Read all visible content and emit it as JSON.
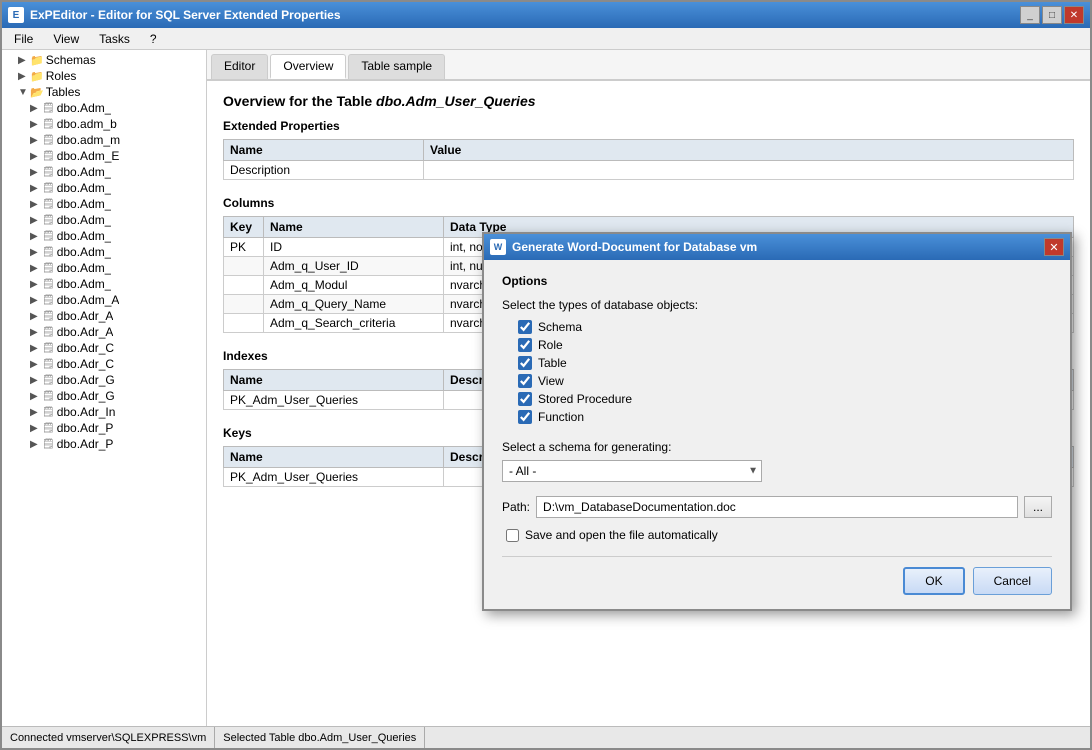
{
  "window": {
    "title": "ExPEditor - Editor for SQL Server Extended Properties",
    "icon_text": "E"
  },
  "menu": {
    "items": [
      "File",
      "View",
      "Tasks",
      "?"
    ]
  },
  "sidebar": {
    "items": [
      {
        "label": "Schemas",
        "type": "folder",
        "indent": 1,
        "arrow": "▶"
      },
      {
        "label": "Roles",
        "type": "folder",
        "indent": 1,
        "arrow": "▶"
      },
      {
        "label": "Tables",
        "type": "folder",
        "indent": 1,
        "arrow": "▼"
      },
      {
        "label": "dbo.Adm_",
        "type": "table",
        "indent": 2,
        "arrow": "▶"
      },
      {
        "label": "dbo.adm_b",
        "type": "table",
        "indent": 2,
        "arrow": "▶"
      },
      {
        "label": "dbo.adm_m",
        "type": "table",
        "indent": 2,
        "arrow": "▶"
      },
      {
        "label": "dbo.Adm_E",
        "type": "table",
        "indent": 2,
        "arrow": "▶"
      },
      {
        "label": "dbo.Adm_",
        "type": "table",
        "indent": 2,
        "arrow": "▶"
      },
      {
        "label": "dbo.Adm_",
        "type": "table",
        "indent": 2,
        "arrow": "▶"
      },
      {
        "label": "dbo.Adm_",
        "type": "table",
        "indent": 2,
        "arrow": "▶"
      },
      {
        "label": "dbo.Adm_",
        "type": "table",
        "indent": 2,
        "arrow": "▶"
      },
      {
        "label": "dbo.Adm_",
        "type": "table",
        "indent": 2,
        "arrow": "▶"
      },
      {
        "label": "dbo.Adm_",
        "type": "table",
        "indent": 2,
        "arrow": "▶"
      },
      {
        "label": "dbo.Adm_",
        "type": "table",
        "indent": 2,
        "arrow": "▶"
      },
      {
        "label": "dbo.Adm_",
        "type": "table",
        "indent": 2,
        "arrow": "▶"
      },
      {
        "label": "dbo.Adm_A",
        "type": "table",
        "indent": 2,
        "arrow": "▶"
      },
      {
        "label": "dbo.Adr_A",
        "type": "table",
        "indent": 2,
        "arrow": "▶"
      },
      {
        "label": "dbo.Adr_A",
        "type": "table",
        "indent": 2,
        "arrow": "▶"
      },
      {
        "label": "dbo.Adr_C",
        "type": "table",
        "indent": 2,
        "arrow": "▶"
      },
      {
        "label": "dbo.Adr_C",
        "type": "table",
        "indent": 2,
        "arrow": "▶"
      },
      {
        "label": "dbo.Adr_G",
        "type": "table",
        "indent": 2,
        "arrow": "▶"
      },
      {
        "label": "dbo.Adr_G",
        "type": "table",
        "indent": 2,
        "arrow": "▶"
      },
      {
        "label": "dbo.Adr_In",
        "type": "table",
        "indent": 2,
        "arrow": "▶"
      },
      {
        "label": "dbo.Adr_P",
        "type": "table",
        "indent": 2,
        "arrow": "▶"
      },
      {
        "label": "dbo.Adr_P",
        "type": "table",
        "indent": 2,
        "arrow": "▶"
      }
    ]
  },
  "tabs": [
    "Editor",
    "Overview",
    "Table sample"
  ],
  "active_tab": "Overview",
  "overview": {
    "title_prefix": "Overview for the Table ",
    "table_name": "dbo.Adm_User_Queries",
    "extended_props_section": "Extended Properties",
    "ext_props_columns": [
      "Name",
      "Value"
    ],
    "ext_props_rows": [
      {
        "name": "Description",
        "value": ""
      }
    ],
    "columns_section": "Columns",
    "columns_headers": [
      "Key",
      "Name",
      "Data Type"
    ],
    "columns_rows": [
      {
        "key": "PK",
        "name": "ID",
        "data_type": "int, not null"
      },
      {
        "key": "",
        "name": "Adm_q_User_ID",
        "data_type": "int, null"
      },
      {
        "key": "",
        "name": "Adm_q_Modul",
        "data_type": "nvarchar(100), n"
      },
      {
        "key": "",
        "name": "Adm_q_Query_Name",
        "data_type": "nvarchar(50), n"
      },
      {
        "key": "",
        "name": "Adm_q_Search_criteria",
        "data_type": "nvarchar(4000)"
      }
    ],
    "indexes_section": "Indexes",
    "indexes_headers": [
      "Name",
      "Descrip"
    ],
    "indexes_rows": [
      {
        "name": "PK_Adm_User_Queries",
        "desc": ""
      }
    ],
    "keys_section": "Keys",
    "keys_headers": [
      "Name",
      "Descrip"
    ],
    "keys_rows": [
      {
        "name": "PK_Adm_User_Queries",
        "desc": ""
      }
    ]
  },
  "status_bar": {
    "left": "Connected vmserver\\SQLEXPRESS\\vm",
    "right": "Selected Table dbo.Adm_User_Queries"
  },
  "dialog": {
    "title": "Generate Word-Document for Database vm",
    "close_btn": "✕",
    "options_label": "Options",
    "select_types_label": "Select the types of database objects:",
    "checkboxes": [
      {
        "label": "Schema",
        "checked": true
      },
      {
        "label": "Role",
        "checked": true
      },
      {
        "label": "Table",
        "checked": true
      },
      {
        "label": "View",
        "checked": true
      },
      {
        "label": "Stored Procedure",
        "checked": true
      },
      {
        "label": "Function",
        "checked": true
      }
    ],
    "schema_label": "Select a schema for generating:",
    "schema_option": "- All -",
    "path_label": "Path:",
    "path_value": "D:\\vm_DatabaseDocumentation.doc",
    "browse_btn": "...",
    "save_open_label": "Save and open the file automatically",
    "save_open_checked": false,
    "ok_btn": "OK",
    "cancel_btn": "Cancel"
  }
}
